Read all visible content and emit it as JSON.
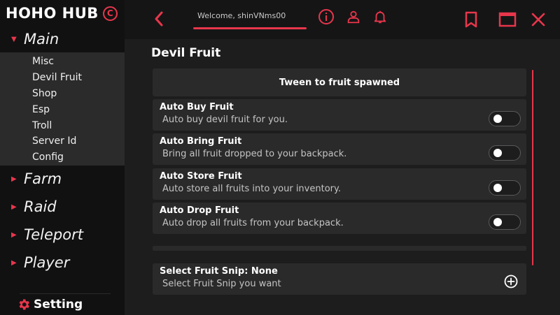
{
  "brand": {
    "name": "HOHO HUB",
    "mark": "C",
    "accent": "#e8364b"
  },
  "sidebar": {
    "main": {
      "label": "Main",
      "icon": "caret-down-icon"
    },
    "submenu": [
      "Misc",
      "Devil Fruit",
      "Shop",
      "Esp",
      "Troll",
      "Server Id",
      "Config"
    ],
    "sections": [
      {
        "label": "Farm",
        "icon": "caret-right-icon"
      },
      {
        "label": "Raid",
        "icon": "caret-right-icon"
      },
      {
        "label": "Teleport",
        "icon": "caret-right-icon"
      },
      {
        "label": "Player",
        "icon": "caret-right-icon"
      }
    ],
    "setting": {
      "label": "Setting",
      "icon": "gear-icon"
    }
  },
  "topbar": {
    "welcome": "Welcome, shinVNms00",
    "icons": [
      "back-arrow-icon",
      "info-icon",
      "user-icon",
      "bell-icon",
      "bookmark-icon",
      "window-icon",
      "close-icon"
    ]
  },
  "page": {
    "title": "Devil Fruit",
    "tween_button": "Tween to fruit spawned",
    "toggles": [
      {
        "title": "Auto Buy Fruit",
        "desc": "Auto buy devil fruit for you.",
        "on": false
      },
      {
        "title": "Auto Bring Fruit",
        "desc": "Bring all fruit dropped to your backpack.",
        "on": false
      },
      {
        "title": "Auto Store Fruit",
        "desc": "Auto store all fruits into your inventory.",
        "on": false
      },
      {
        "title": "Auto Drop Fruit",
        "desc": "Auto drop all fruits from your backpack.",
        "on": false
      }
    ],
    "dropdown": {
      "title": "Select Fruit Snip: None",
      "desc": "Select Fruit Snip you want",
      "icon": "plus-circle-icon"
    }
  }
}
